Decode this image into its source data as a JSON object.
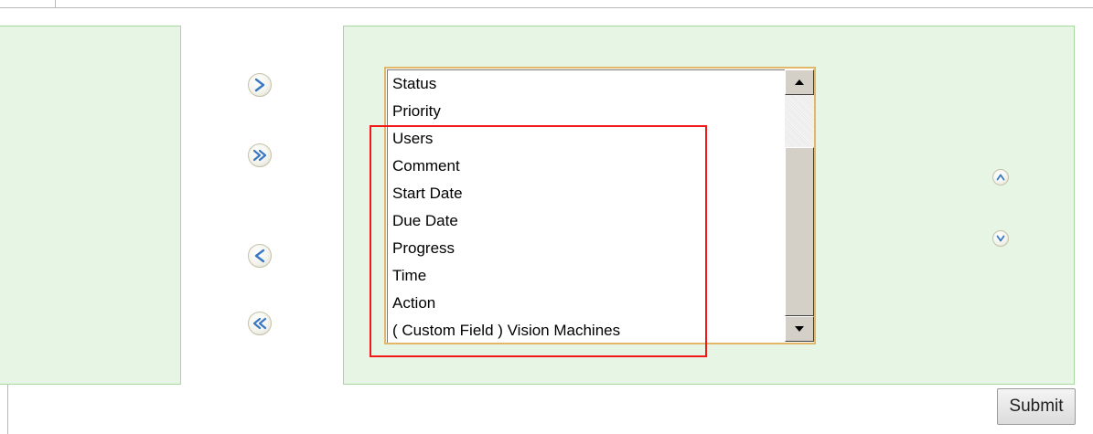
{
  "buttons": {
    "move_right": "move-right",
    "move_all_right": "move-all-right",
    "move_left": "move-left",
    "move_all_left": "move-all-left",
    "move_up": "move-up",
    "move_down": "move-down"
  },
  "selected_columns": [
    "Status",
    "Priority",
    "Users",
    "Comment",
    "Start Date",
    "Due Date",
    "Progress",
    "Time",
    "Action",
    "( Custom Field ) Vision Machines"
  ],
  "submit_label": "Submit",
  "colors": {
    "panel_bg": "#e6f5e4",
    "panel_border": "#a9d6a1",
    "listbox_border": "#e2b868",
    "highlight": "#f01818",
    "arrow": "#3a78c4"
  }
}
